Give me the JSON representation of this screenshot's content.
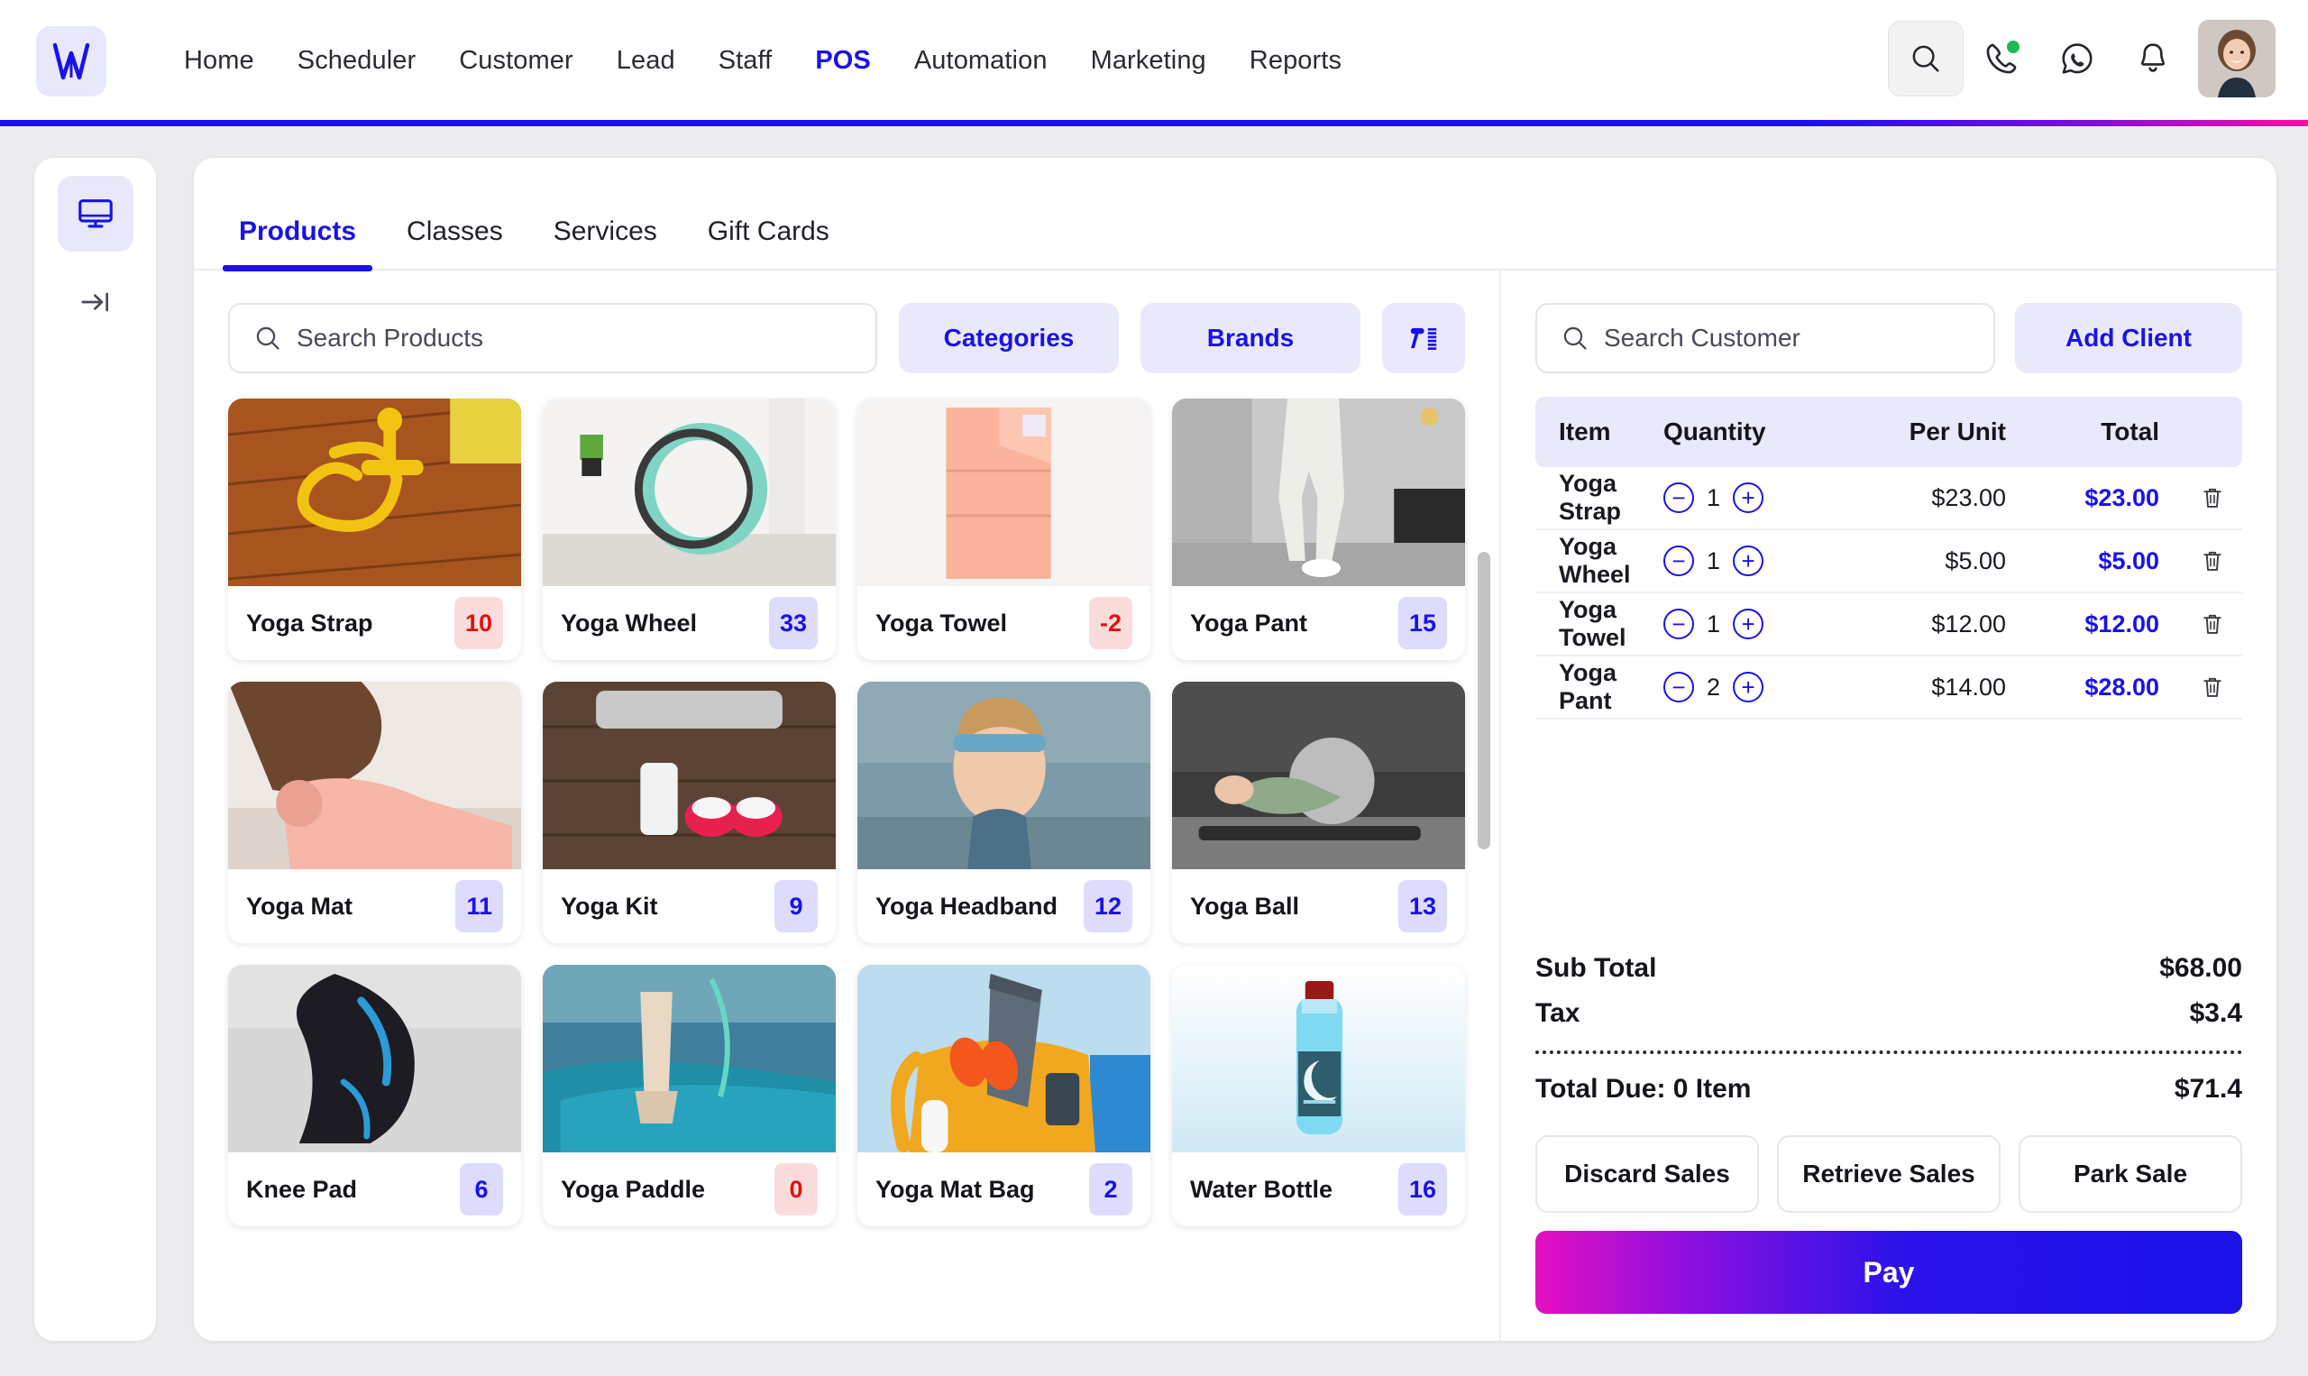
{
  "header": {
    "logo_alt": "W",
    "nav": [
      {
        "label": "Home",
        "active": false
      },
      {
        "label": "Scheduler",
        "active": false
      },
      {
        "label": "Customer",
        "active": false
      },
      {
        "label": "Lead",
        "active": false
      },
      {
        "label": "Staff",
        "active": false
      },
      {
        "label": "POS",
        "active": true
      },
      {
        "label": "Automation",
        "active": false
      },
      {
        "label": "Marketing",
        "active": false
      },
      {
        "label": "Reports",
        "active": false
      }
    ],
    "icons": [
      "search-icon",
      "phone-call-icon",
      "whatsapp-icon",
      "bell-icon",
      "user-avatar"
    ],
    "accent_color": "#1a12e8",
    "rule_gradient_end": "#f411a8"
  },
  "sidebar": {
    "items": [
      {
        "icon": "monitor-icon",
        "active": true
      },
      {
        "icon": "collapse-right-icon",
        "active": false
      }
    ]
  },
  "tabs": [
    {
      "label": "Products",
      "active": true
    },
    {
      "label": "Classes",
      "active": false
    },
    {
      "label": "Services",
      "active": false
    },
    {
      "label": "Gift Cards",
      "active": false
    }
  ],
  "product_filters": {
    "search_placeholder": "Search Products",
    "categories_label": "Categories",
    "brands_label": "Brands",
    "scanner_icon": "barcode-scanner-icon"
  },
  "products": [
    {
      "name": "Yoga Strap",
      "stock": "10",
      "stock_state": "low"
    },
    {
      "name": "Yoga Wheel",
      "stock": "33",
      "stock_state": "ok"
    },
    {
      "name": "Yoga Towel",
      "stock": "-2",
      "stock_state": "low"
    },
    {
      "name": "Yoga Pant",
      "stock": "15",
      "stock_state": "ok"
    },
    {
      "name": "Yoga Mat",
      "stock": "11",
      "stock_state": "ok"
    },
    {
      "name": "Yoga Kit",
      "stock": "9",
      "stock_state": "ok"
    },
    {
      "name": "Yoga Headband",
      "stock": "12",
      "stock_state": "ok"
    },
    {
      "name": "Yoga Ball",
      "stock": "13",
      "stock_state": "ok"
    },
    {
      "name": "Knee Pad",
      "stock": "6",
      "stock_state": "ok"
    },
    {
      "name": "Yoga Paddle",
      "stock": "0",
      "stock_state": "low"
    },
    {
      "name": "Yoga Mat Bag",
      "stock": "2",
      "stock_state": "ok"
    },
    {
      "name": "Water Bottle",
      "stock": "16",
      "stock_state": "ok"
    }
  ],
  "cart": {
    "customer_search_placeholder": "Search Customer",
    "add_client_label": "Add Client",
    "columns": {
      "item": "Item",
      "quantity": "Quantity",
      "per_unit": "Per Unit",
      "total": "Total"
    },
    "rows": [
      {
        "item": "Yoga Strap",
        "qty": "1",
        "per_unit": "$23.00",
        "total": "$23.00"
      },
      {
        "item": "Yoga Wheel",
        "qty": "1",
        "per_unit": "$5.00",
        "total": "$5.00"
      },
      {
        "item": "Yoga Towel",
        "qty": "1",
        "per_unit": "$12.00",
        "total": "$12.00"
      },
      {
        "item": "Yoga Pant",
        "qty": "2",
        "per_unit": "$14.00",
        "total": "$28.00"
      }
    ],
    "sub_total_label": "Sub Total",
    "sub_total_value": "$68.00",
    "tax_label": "Tax",
    "tax_value": "$3.4",
    "total_due_label": "Total Due: 0 Item",
    "total_due_value": "$71.4",
    "actions": [
      "Discard Sales",
      "Retrieve Sales",
      "Park Sale"
    ],
    "pay_label": "Pay"
  }
}
